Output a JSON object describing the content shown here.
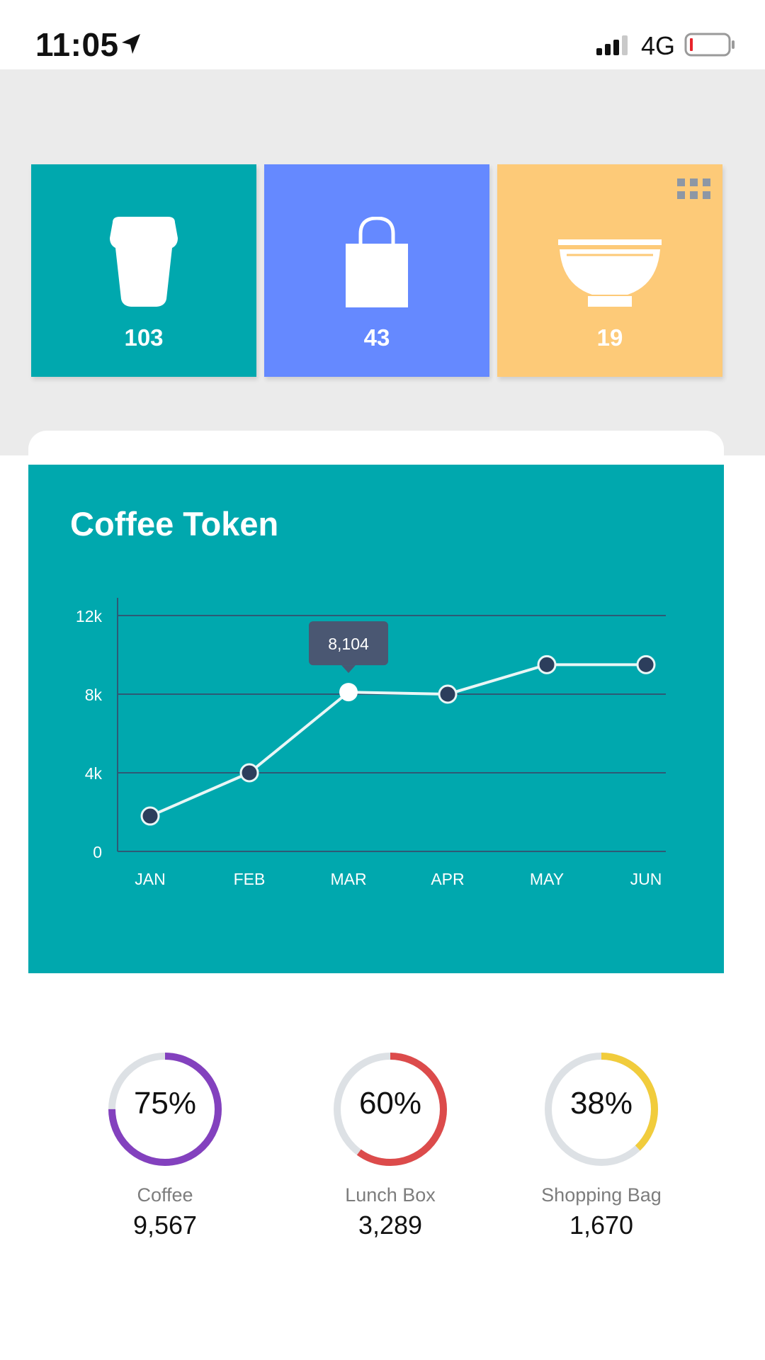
{
  "status_bar": {
    "time": "11:05",
    "network": "4G",
    "location_icon": "location-arrow-icon",
    "signal_icon": "signal-bars-icon",
    "battery_icon": "battery-low-icon"
  },
  "tiles": [
    {
      "icon": "coffee-cup-icon",
      "value": "103",
      "color": "#00a8ae"
    },
    {
      "icon": "shopping-bag-icon",
      "value": "43",
      "color": "#6589ff"
    },
    {
      "icon": "bowl-icon",
      "value": "19",
      "color": "#fdca78"
    }
  ],
  "menu_icon": "apps-grid-icon",
  "chart": {
    "title": "Coffee Token",
    "tooltip": "8,104"
  },
  "chart_data": {
    "type": "line",
    "title": "Coffee Token",
    "categories": [
      "JAN",
      "FEB",
      "MAR",
      "APR",
      "MAY",
      "JUN"
    ],
    "values": [
      1800,
      4000,
      8104,
      8000,
      9500,
      9500
    ],
    "yticks": [
      "0",
      "4k",
      "8k",
      "12k"
    ],
    "ylim": [
      0,
      12000
    ],
    "grid": true,
    "highlighted_point": {
      "category": "MAR",
      "label": "8,104"
    },
    "background": "#00a8ae"
  },
  "donuts": [
    {
      "percent": 75,
      "percent_label": "75%",
      "label": "Coffee",
      "value": "9,567",
      "color": "#8341be"
    },
    {
      "percent": 60,
      "percent_label": "60%",
      "label": "Lunch Box",
      "value": "3,289",
      "color": "#dc4b4b"
    },
    {
      "percent": 38,
      "percent_label": "38%",
      "label": "Shopping Bag",
      "value": "1,670",
      "color": "#f1cc3c"
    }
  ]
}
